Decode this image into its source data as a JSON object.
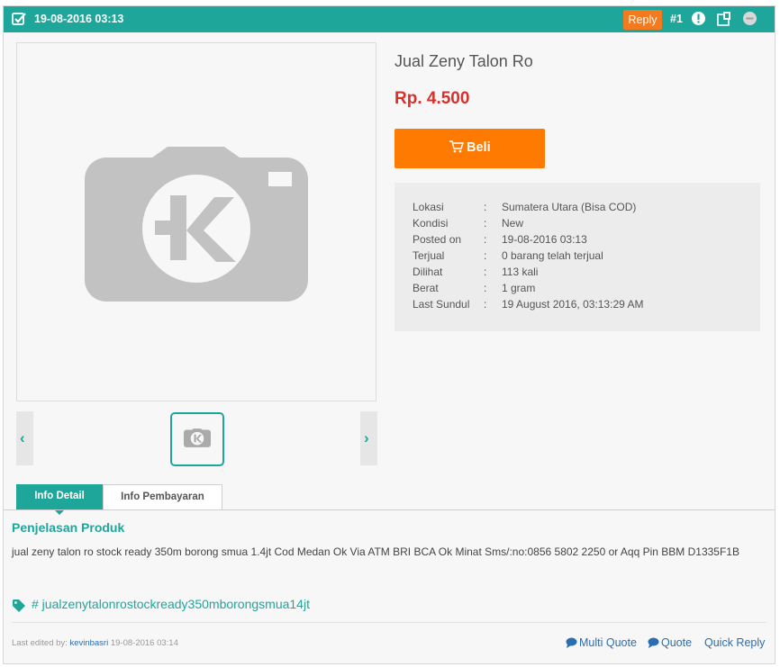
{
  "header": {
    "date": "19-08-2016 03:13",
    "reply_label": "Reply",
    "post_number": "#1",
    "colors": {
      "bar": "#1fa69a",
      "reply": "#f47a20"
    }
  },
  "product": {
    "title": "Jual Zeny Talon Ro",
    "price": "Rp. 4.500",
    "buy_label": "Beli",
    "details": [
      {
        "label": "Lokasi",
        "value": "Sumatera Utara (Bisa COD)"
      },
      {
        "label": "Kondisi",
        "value": "New"
      },
      {
        "label": "Posted on",
        "value": "19-08-2016 03:13"
      },
      {
        "label": "Terjual",
        "value": "0 barang telah terjual"
      },
      {
        "label": "Dilihat",
        "value": "113 kali"
      },
      {
        "label": "Berat",
        "value": "1 gram"
      },
      {
        "label": "Last Sundul",
        "value": "19 August 2016, 03:13:29 AM"
      }
    ],
    "separator": ":"
  },
  "gallery": {
    "prev_icon": "chevron-left-icon",
    "next_icon": "chevron-right-icon",
    "placeholder_icon": "camera-k-icon"
  },
  "tabs": [
    {
      "label": "Info Detail",
      "active": true
    },
    {
      "label": "Info Pembayaran",
      "active": false
    }
  ],
  "description": {
    "heading": "Penjelasan Produk",
    "text": "jual zeny talon ro stock ready 350m borong smua 1.4jt Cod Medan Ok Via ATM BRI BCA Ok Minat Sms/:no:0856 5802 2250 or Aqq Pin BBM D1335F1B"
  },
  "tag": "# jualzenytalonrostockready350mborongsmua14jt",
  "footer": {
    "edited_prefix": "Last edited by:",
    "edited_user": "kevinbasri",
    "edited_time": "19-08-2016 03:14",
    "multi_quote": "Multi Quote",
    "quote": "Quote",
    "quick_reply": "Quick Reply"
  }
}
